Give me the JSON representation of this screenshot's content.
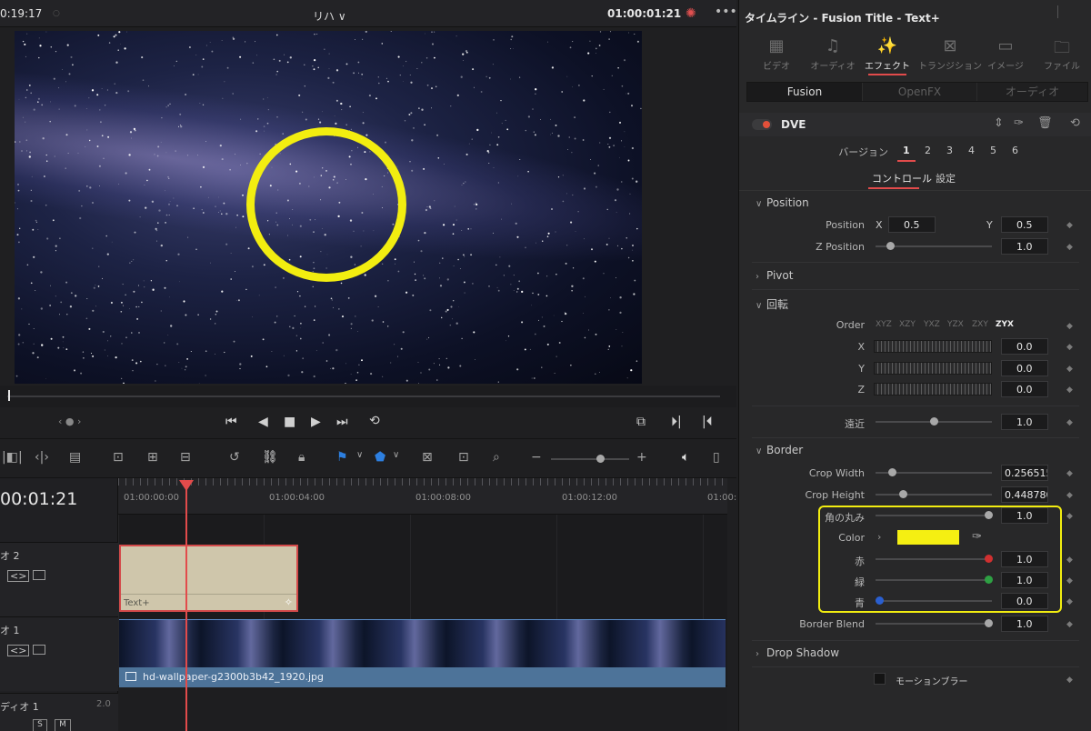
{
  "viewer": {
    "timecode_left": "0:19:17",
    "title": "リハ ∨",
    "timecode_right": "01:00:01:21"
  },
  "timeline": {
    "current_tc": "00:01:21",
    "ticks": [
      "01:00:00:00",
      "01:00:04:00",
      "01:00:08:00",
      "01:00:12:00",
      "01:00:"
    ],
    "tracks": [
      {
        "name": "オ 2"
      },
      {
        "name": "オ 1"
      },
      {
        "name": "ディオ 1",
        "level": "2.0"
      }
    ],
    "clip_title_label": "Text+",
    "clip_video_label": "hd-wallpaper-g2300b3b42_1920.jpg",
    "audio_buttons": [
      "S",
      "M"
    ]
  },
  "inspector": {
    "title": "タイムライン - Fusion Title - Text+",
    "categories": [
      {
        "label": "ビデオ",
        "icon": "film-icon",
        "active": false
      },
      {
        "label": "オーディオ",
        "icon": "music-note-icon",
        "active": false
      },
      {
        "label": "エフェクト",
        "icon": "magic-wand-icon",
        "active": true
      },
      {
        "label": "トランジション",
        "icon": "transition-icon",
        "active": false
      },
      {
        "label": "イメージ",
        "icon": "image-icon",
        "active": false
      },
      {
        "label": "ファイル",
        "icon": "file-icon",
        "active": false
      }
    ],
    "subtabs": [
      {
        "label": "Fusion",
        "active": true
      },
      {
        "label": "OpenFX",
        "active": false
      },
      {
        "label": "オーディオ",
        "active": false
      }
    ],
    "effect_name": "DVE",
    "version_label": "バージョン",
    "versions": [
      "1",
      "2",
      "3",
      "4",
      "5",
      "6"
    ],
    "control_tabs": [
      "コントロール",
      "設定"
    ],
    "position": {
      "section": "Position",
      "label": "Position",
      "x_label": "X",
      "x": "0.5",
      "y_label": "Y",
      "y": "0.5",
      "z_label": "Z Position",
      "z": "1.0"
    },
    "pivot": {
      "section": "Pivot"
    },
    "rotation": {
      "section": "回転",
      "order_label": "Order",
      "orders": [
        "XYZ",
        "XZY",
        "YXZ",
        "YZX",
        "ZXY",
        "ZYX"
      ],
      "active_order": "ZYX",
      "x_label": "X",
      "x": "0.0",
      "y_label": "Y",
      "y": "0.0",
      "z_label": "Z",
      "z": "0.0"
    },
    "perspective": {
      "label": "遠近",
      "value": "1.0"
    },
    "border": {
      "section": "Border",
      "crop_width_label": "Crop Width",
      "crop_width": "0.256515",
      "crop_height_label": "Crop Height",
      "crop_height": "0.448780",
      "roundness_label": "角の丸み",
      "roundness": "1.0",
      "color_label": "Color",
      "color_swatch": "#f5ef12",
      "red_label": "赤",
      "red": "1.0",
      "green_label": "緑",
      "green": "1.0",
      "blue_label": "青",
      "blue": "0.0",
      "blend_label": "Border Blend",
      "blend": "1.0"
    },
    "drop_shadow": {
      "section": "Drop Shadow"
    },
    "motion_blur_label": "モーションブラー"
  }
}
